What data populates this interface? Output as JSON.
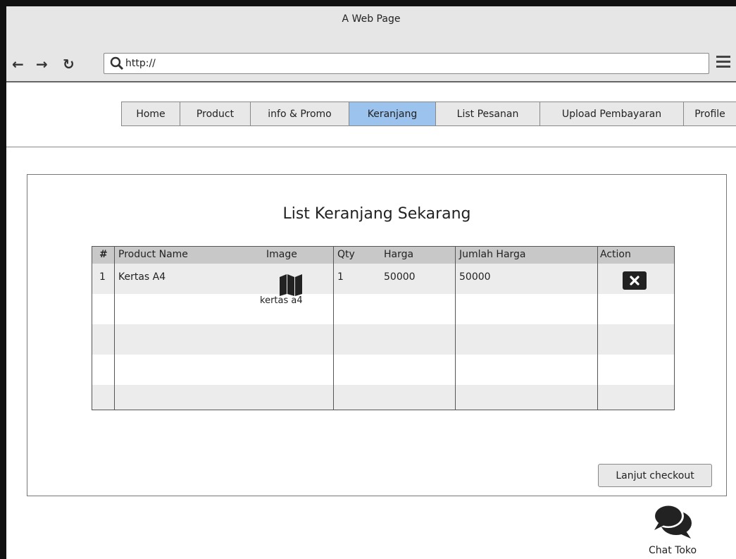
{
  "window": {
    "title": "A Web Page"
  },
  "browser": {
    "url": "http://",
    "icons": {
      "back": "arrow-left-icon",
      "forward": "arrow-right-icon",
      "reload": "reload-icon",
      "search": "search-icon",
      "menu": "hamburger-menu-icon"
    }
  },
  "nav": {
    "tabs": [
      {
        "label": "Home",
        "active": false
      },
      {
        "label": "Product",
        "active": false
      },
      {
        "label": "info & Promo",
        "active": false
      },
      {
        "label": "Keranjang",
        "active": true
      },
      {
        "label": "List Pesanan",
        "active": false
      },
      {
        "label": "Upload Pembayaran",
        "active": false
      },
      {
        "label": "Profile",
        "active": false
      }
    ]
  },
  "cart": {
    "title": "List Keranjang Sekarang",
    "columns": [
      "#",
      "Product Name",
      "Image",
      "Qty",
      "Harga",
      "Jumlah Harga",
      "Action"
    ],
    "rows": [
      {
        "no": "1",
        "product_name": "Kertas A4",
        "image_icon": "map-icon",
        "image_caption": "kertas a4",
        "qty": "1",
        "harga": "50000",
        "jumlah_harga": "50000",
        "action_icon": "close-icon"
      }
    ],
    "checkout_label": "Lanjut checkout"
  },
  "chat": {
    "label": "Chat Toko",
    "icon": "chat-bubbles-icon"
  },
  "colors": {
    "active_tab": "#9cc2ee",
    "header_row": "#c8c8c8",
    "stripe": "#ececec"
  }
}
